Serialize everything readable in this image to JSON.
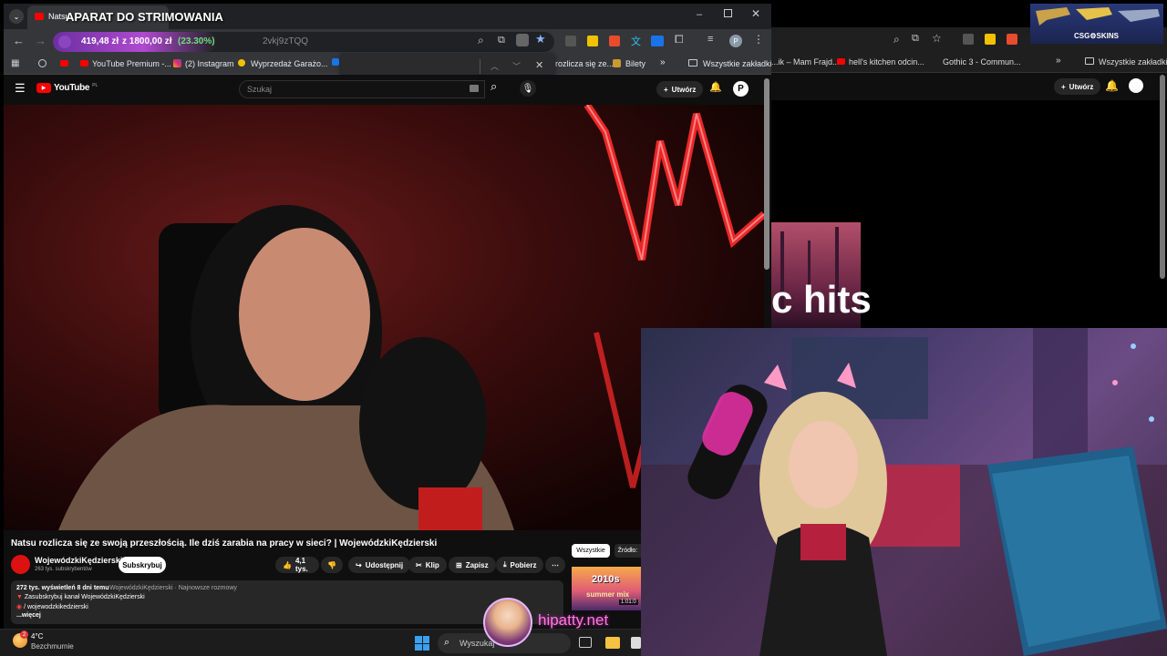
{
  "overlay": {
    "stream_title": "APARAT DO STRIMOWANIA",
    "price_main": "419,48 zł",
    "price_from": "z 1800,00 zł",
    "price_pct": "(23.30%)",
    "address_fragment": "2vkj9zTQQ",
    "sponsor_badge": "CSG⚙SKINS",
    "watermark": "hipatty.net"
  },
  "tab": {
    "title": "Natsu..."
  },
  "bookmarks": [
    {
      "label": "YouTube Premium -..."
    },
    {
      "label": "(2) Instagram"
    },
    {
      "label": "Wyprzedaż Garażo..."
    },
    {
      "label": "rozlicza się ze..."
    },
    {
      "label": "Bilety"
    },
    {
      "label": "Wszystkie zakładki"
    }
  ],
  "bg_bookmarks": [
    {
      "label": "...ik – Mam Frajd..."
    },
    {
      "label": "hell's kitchen odcin..."
    },
    {
      "label": "Gothic 3 - Commun..."
    },
    {
      "label": "Wszystkie zakładki"
    }
  ],
  "bg_youtube": {
    "create": "Utwórz",
    "thumb_text": "hits"
  },
  "youtube": {
    "logo": "YouTube",
    "logo_region": "PL",
    "search_placeholder": "Szukaj",
    "create": "Utwórz",
    "avatar": "P",
    "video_title": "Natsu rozlicza się ze swoją przeszłością. Ile dziś zarabia na pracy w sieci? | WojewódzkiKędzierski",
    "channel": "WojewódzkiKędzierski",
    "subscribers": "263 tys. subskrybentów",
    "subscribe": "Subskrybuj",
    "likes": "4,1 tys.",
    "share": "Udostępnij",
    "clip": "Klip",
    "save": "Zapisz",
    "download": "Pobierz",
    "filter_all": "Wszystkie",
    "filter_source": "Źródło:",
    "views_line": "272 tys. wyświetleń  8 dni temu",
    "desc_channel_line": "WojewódzkiKędzierski · Najnowsze rozmowy",
    "desc_line1": "Zasubskrybuj kanał WojewódzkiKędzierski",
    "desc_line2": "/ wojewodzkikedzierski",
    "more": "...więcej",
    "rec_thumb_text": "2010s",
    "rec_thumb_sub": "summer mix",
    "rec_duration": "1:01:0"
  },
  "weather": {
    "temp": "4°C",
    "cond": "Bezchmurnie"
  },
  "taskbar": {
    "search_placeholder": "Wyszukaj"
  },
  "colors": {
    "price_green": "#6ee17a",
    "yt_red": "#ff0000",
    "accent_star": "#8ab4f8"
  }
}
